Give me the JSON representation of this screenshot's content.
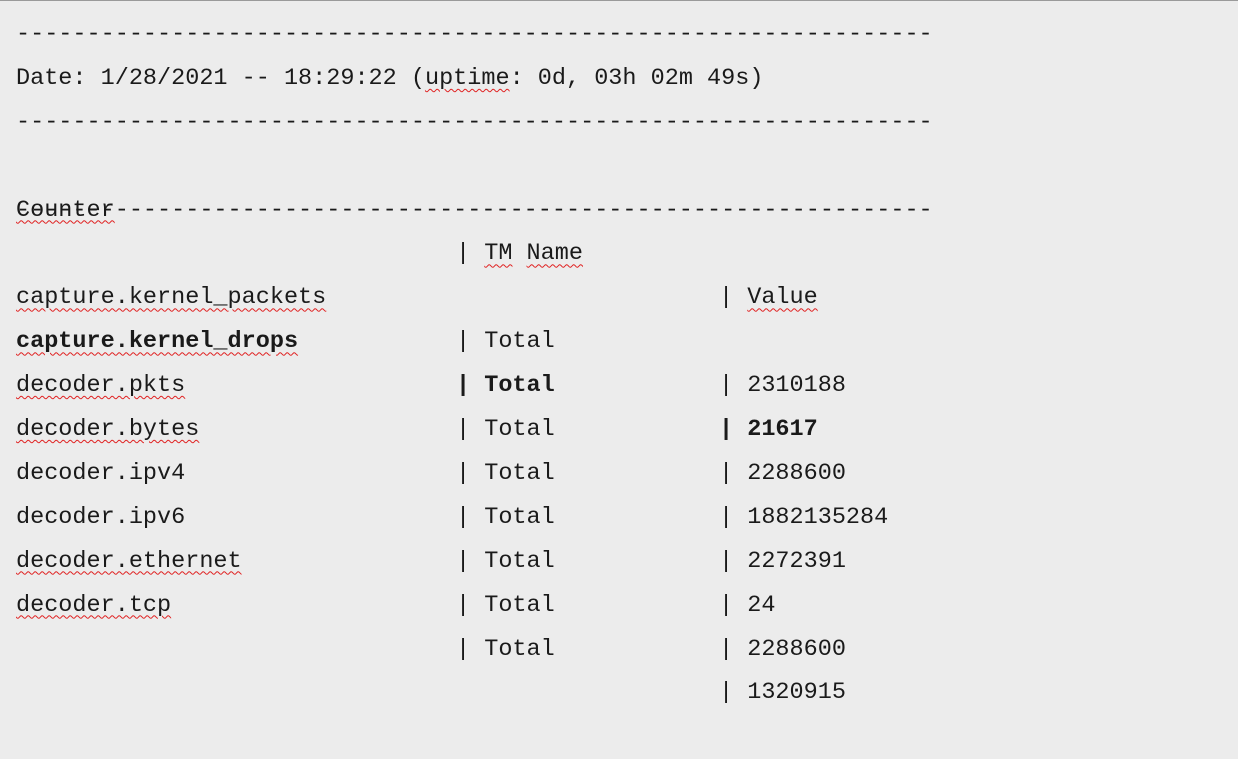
{
  "separator": "-----------------------------------------------------------------",
  "date_line": {
    "prefix": "Date: 1/28/2021 -- 18:29:22 (",
    "uptime_word": "uptime",
    "suffix": ": 0d, 03h 02m 49s)"
  },
  "header": {
    "counter": "Counter",
    "pipe1": "| ",
    "tm_a": "TM",
    "space": " ",
    "tm_b": "Name",
    "pipe2": "| ",
    "value": "Value"
  },
  "rows": [
    {
      "counter": "capture.kernel_packets",
      "pipe1": "| ",
      "tm": "Total",
      "pipe2": "| ",
      "value": "2310188"
    },
    {
      "counter": "capture.kernel_drops",
      "pipe1": "| ",
      "tm": "Total",
      "pipe2": "| ",
      "value": "21617"
    },
    {
      "counter": "decoder.pkts",
      "pipe1": "| ",
      "tm": "Total",
      "pipe2": "| ",
      "value": "2288600"
    },
    {
      "counter": "decoder.bytes",
      "pipe1": "| ",
      "tm": "Total",
      "pipe2": "| ",
      "value": "1882135284"
    },
    {
      "counter": "decoder.ipv4",
      "pipe1": "| ",
      "tm": "Total",
      "pipe2": "| ",
      "value": "2272391"
    },
    {
      "counter": "decoder.ipv6",
      "pipe1": "| ",
      "tm": "Total",
      "pipe2": "| ",
      "value": "24"
    },
    {
      "counter": "decoder.ethernet",
      "pipe1": "| ",
      "tm": "Total",
      "pipe2": "| ",
      "value": "2288600"
    },
    {
      "counter": "decoder.tcp",
      "pipe1": "| ",
      "tm": "Total",
      "pipe2": "| ",
      "value": "1320915"
    }
  ],
  "colors": {
    "background": "#ececec",
    "text": "#1a1a1a",
    "spellcheck_underline": "#e02020"
  }
}
